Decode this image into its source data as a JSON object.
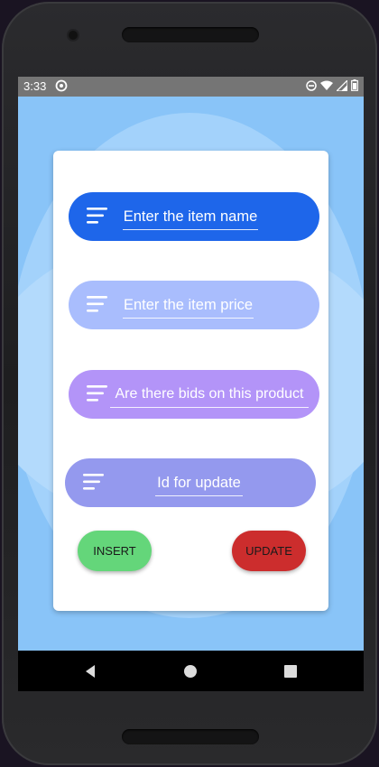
{
  "statusbar": {
    "time": "3:33",
    "icons": [
      "sync-icon",
      "do-not-disturb-icon",
      "wifi-icon",
      "cell-signal-icon",
      "battery-icon"
    ]
  },
  "form": {
    "item_name_placeholder": "Enter the item name",
    "item_price_placeholder": "Enter the item price",
    "bids_placeholder": "Are there bids on this product",
    "update_id_placeholder": "Id for update"
  },
  "buttons": {
    "insert_label": "INSERT",
    "update_label": "UPDATE"
  },
  "colors": {
    "background": "#89c4f8",
    "name_pill": "#1e66ea",
    "price_pill": "#a9bdfd",
    "bids_pill": "#b394f8",
    "update_id_pill": "#9499ee",
    "insert_button": "#64d67a",
    "update_button": "#cc2d2d"
  },
  "navbar": {
    "icons": [
      "back-icon",
      "home-icon",
      "recents-icon"
    ]
  }
}
